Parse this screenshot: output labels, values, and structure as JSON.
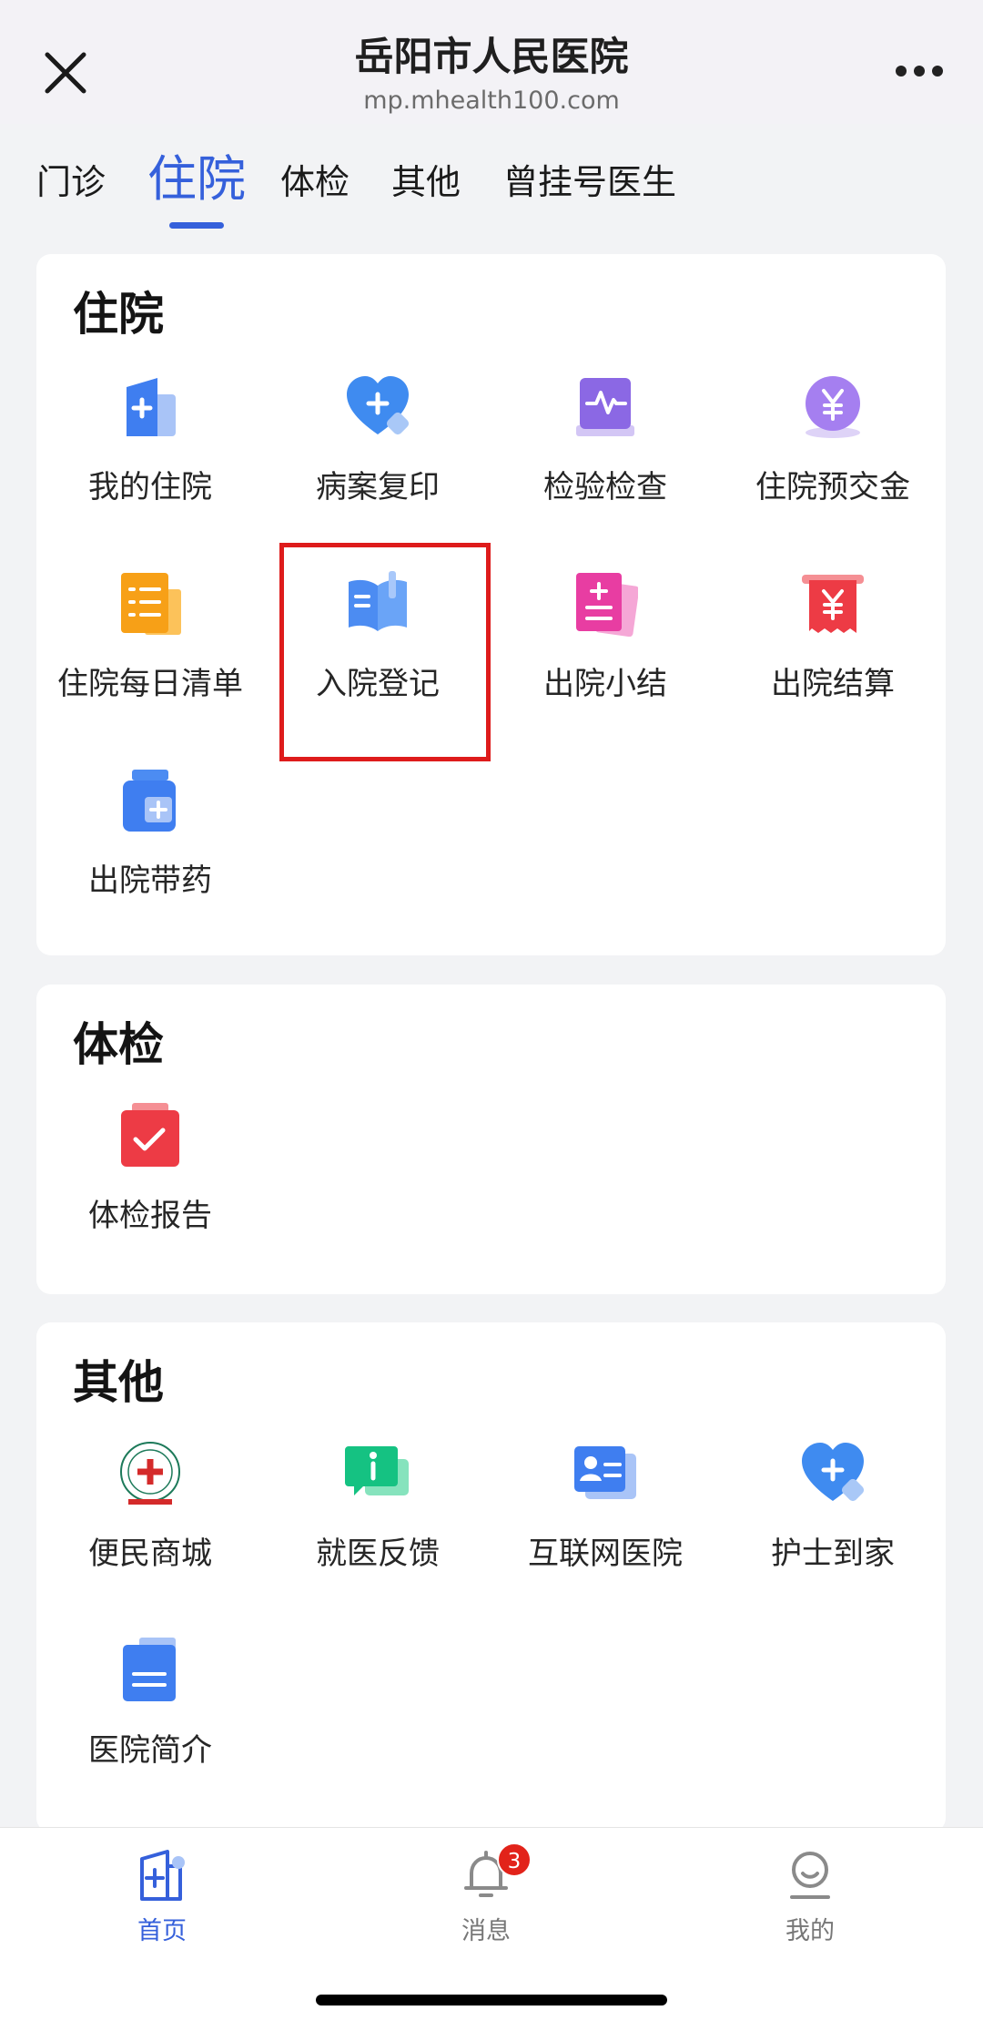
{
  "header": {
    "title": "岳阳市人民医院",
    "url": "mp.mhealth100.com",
    "close_icon": "close-icon",
    "more_icon": "more-icon"
  },
  "tabs": [
    {
      "label": "门诊",
      "active": false
    },
    {
      "label": "住院",
      "active": true
    },
    {
      "label": "体检",
      "active": false
    },
    {
      "label": "其他",
      "active": false
    },
    {
      "label": "曾挂号医生",
      "active": false
    }
  ],
  "sections": {
    "inpatient": {
      "title": "住院",
      "items": [
        {
          "label": "我的住院",
          "icon": "hospital-icon"
        },
        {
          "label": "病案复印",
          "icon": "heart-plus-icon"
        },
        {
          "label": "检验检查",
          "icon": "pulse-monitor-icon"
        },
        {
          "label": "住院预交金",
          "icon": "yuan-coin-icon"
        },
        {
          "label": "住院每日清单",
          "icon": "list-icon"
        },
        {
          "label": "入院登记",
          "icon": "notebook-pen-icon"
        },
        {
          "label": "出院小结",
          "icon": "document-plus-icon"
        },
        {
          "label": "出院结算",
          "icon": "receipt-yuan-icon"
        },
        {
          "label": "出院带药",
          "icon": "medicine-bottle-icon"
        }
      ]
    },
    "checkup": {
      "title": "体检",
      "items": [
        {
          "label": "体检报告",
          "icon": "clipboard-check-icon"
        }
      ]
    },
    "other": {
      "title": "其他",
      "items": [
        {
          "label": "便民商城",
          "icon": "hospital-logo-icon"
        },
        {
          "label": "就医反馈",
          "icon": "feedback-info-icon"
        },
        {
          "label": "互联网医院",
          "icon": "id-card-icon"
        },
        {
          "label": "护士到家",
          "icon": "heart-plus-icon"
        },
        {
          "label": "医院简介",
          "icon": "document-lines-icon"
        }
      ]
    }
  },
  "bottom_nav": [
    {
      "label": "首页",
      "icon": "home-hospital-icon",
      "active": true
    },
    {
      "label": "消息",
      "icon": "bell-icon",
      "active": false,
      "badge": "3"
    },
    {
      "label": "我的",
      "icon": "user-icon",
      "active": false
    }
  ],
  "colors": {
    "accent": "#3560db",
    "highlight": "#de1b1b",
    "badge": "#e2231a"
  }
}
